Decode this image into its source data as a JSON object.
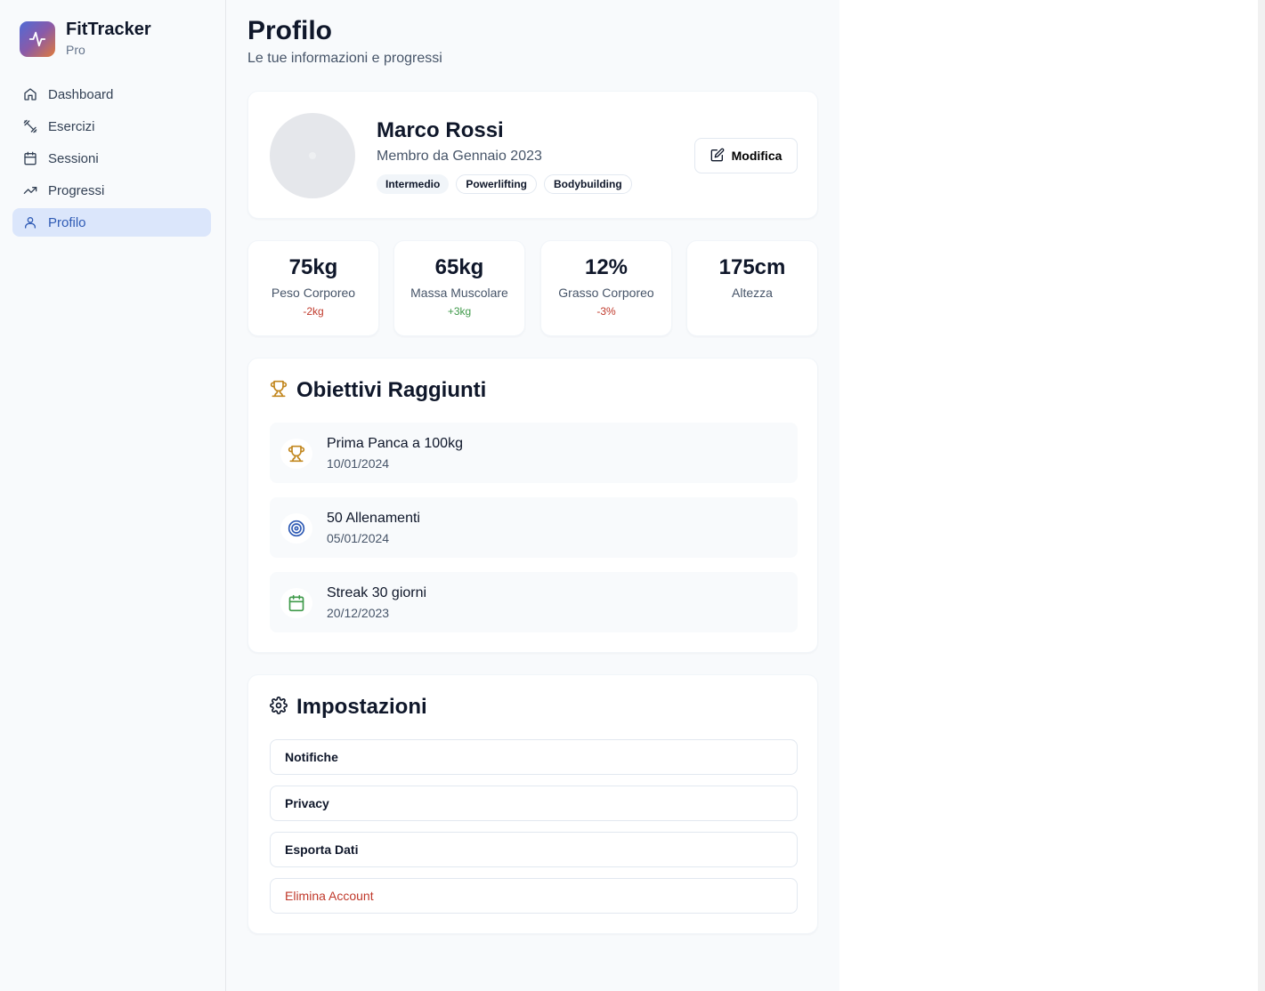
{
  "app": {
    "name": "FitTracker",
    "tier": "Pro"
  },
  "nav": [
    {
      "label": "Dashboard",
      "icon": "home-icon",
      "active": false
    },
    {
      "label": "Esercizi",
      "icon": "dumbbell-icon",
      "active": false
    },
    {
      "label": "Sessioni",
      "icon": "calendar-icon",
      "active": false
    },
    {
      "label": "Progressi",
      "icon": "trending-up-icon",
      "active": false
    },
    {
      "label": "Profilo",
      "icon": "user-icon",
      "active": true
    }
  ],
  "page": {
    "title": "Profilo",
    "subtitle": "Le tue informazioni e progressi"
  },
  "profile": {
    "name": "Marco Rossi",
    "member_since": "Membro da Gennaio 2023",
    "tags": [
      "Intermedio",
      "Powerlifting",
      "Bodybuilding"
    ],
    "edit_label": "Modifica"
  },
  "stats": [
    {
      "value": "75kg",
      "label": "Peso Corporeo",
      "delta": "-2kg",
      "delta_color": "#c0392b"
    },
    {
      "value": "65kg",
      "label": "Massa Muscolare",
      "delta": "+3kg",
      "delta_color": "#3f9a4a"
    },
    {
      "value": "12%",
      "label": "Grasso Corporeo",
      "delta": "-3%",
      "delta_color": "#c0392b"
    },
    {
      "value": "175cm",
      "label": "Altezza",
      "delta": "",
      "delta_color": ""
    }
  ],
  "goals": {
    "title": "Obiettivi Raggiunti",
    "items": [
      {
        "title": "Prima Panca a 100kg",
        "date": "10/01/2024",
        "icon": "trophy-icon",
        "color": "#c2871e"
      },
      {
        "title": "50 Allenamenti",
        "date": "05/01/2024",
        "icon": "target-icon",
        "color": "#2f5bb5"
      },
      {
        "title": "Streak 30 giorni",
        "date": "20/12/2023",
        "icon": "calendar-icon",
        "color": "#3f9a4a"
      }
    ]
  },
  "settings": {
    "title": "Impostazioni",
    "items": [
      "Notifiche",
      "Privacy",
      "Esporta Dati",
      "Elimina Account"
    ]
  },
  "colors": {
    "accent": "#2f5bb5",
    "active_bg": "#dbe6fb",
    "danger": "#c0392b",
    "success": "#3f9a4a",
    "trophy": "#c2871e"
  }
}
